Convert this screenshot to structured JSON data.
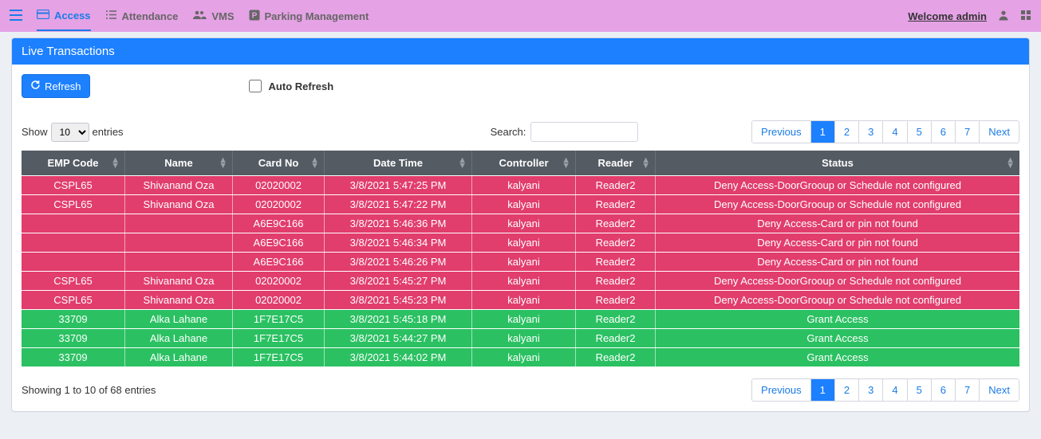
{
  "nav": {
    "access": "Access",
    "attendance": "Attendance",
    "vms": "VMS",
    "parking": "Parking Management",
    "welcome": "Welcome admin"
  },
  "panel": {
    "title": "Live Transactions",
    "refresh": "Refresh",
    "auto_refresh": "Auto Refresh"
  },
  "table_controls": {
    "show": "Show",
    "entries": "entries",
    "page_size": "10",
    "search_label": "Search:",
    "info": "Showing 1 to 10 of 68 entries"
  },
  "pager": {
    "previous": "Previous",
    "next": "Next",
    "pages": [
      "1",
      "2",
      "3",
      "4",
      "5",
      "6",
      "7"
    ],
    "active": "1"
  },
  "columns": {
    "emp": "EMP Code",
    "name": "Name",
    "card": "Card No",
    "date": "Date Time",
    "controller": "Controller",
    "reader": "Reader",
    "status": "Status"
  },
  "rows": [
    {
      "emp": "CSPL65",
      "name": "Shivanand Oza",
      "card": "02020002",
      "date": "3/8/2021 5:47:25 PM",
      "controller": "kalyani",
      "reader": "Reader2",
      "status": "Deny Access-DoorGrooup or Schedule not configured",
      "kind": "deny"
    },
    {
      "emp": "CSPL65",
      "name": "Shivanand Oza",
      "card": "02020002",
      "date": "3/8/2021 5:47:22 PM",
      "controller": "kalyani",
      "reader": "Reader2",
      "status": "Deny Access-DoorGrooup or Schedule not configured",
      "kind": "deny"
    },
    {
      "emp": "",
      "name": "",
      "card": "A6E9C166",
      "date": "3/8/2021 5:46:36 PM",
      "controller": "kalyani",
      "reader": "Reader2",
      "status": "Deny Access-Card or pin not found",
      "kind": "deny"
    },
    {
      "emp": "",
      "name": "",
      "card": "A6E9C166",
      "date": "3/8/2021 5:46:34 PM",
      "controller": "kalyani",
      "reader": "Reader2",
      "status": "Deny Access-Card or pin not found",
      "kind": "deny"
    },
    {
      "emp": "",
      "name": "",
      "card": "A6E9C166",
      "date": "3/8/2021 5:46:26 PM",
      "controller": "kalyani",
      "reader": "Reader2",
      "status": "Deny Access-Card or pin not found",
      "kind": "deny"
    },
    {
      "emp": "CSPL65",
      "name": "Shivanand Oza",
      "card": "02020002",
      "date": "3/8/2021 5:45:27 PM",
      "controller": "kalyani",
      "reader": "Reader2",
      "status": "Deny Access-DoorGrooup or Schedule not configured",
      "kind": "deny"
    },
    {
      "emp": "CSPL65",
      "name": "Shivanand Oza",
      "card": "02020002",
      "date": "3/8/2021 5:45:23 PM",
      "controller": "kalyani",
      "reader": "Reader2",
      "status": "Deny Access-DoorGrooup or Schedule not configured",
      "kind": "deny"
    },
    {
      "emp": "33709",
      "name": "Alka Lahane",
      "card": "1F7E17C5",
      "date": "3/8/2021 5:45:18 PM",
      "controller": "kalyani",
      "reader": "Reader2",
      "status": "Grant Access",
      "kind": "grant"
    },
    {
      "emp": "33709",
      "name": "Alka Lahane",
      "card": "1F7E17C5",
      "date": "3/8/2021 5:44:27 PM",
      "controller": "kalyani",
      "reader": "Reader2",
      "status": "Grant Access",
      "kind": "grant"
    },
    {
      "emp": "33709",
      "name": "Alka Lahane",
      "card": "1F7E17C5",
      "date": "3/8/2021 5:44:02 PM",
      "controller": "kalyani",
      "reader": "Reader2",
      "status": "Grant Access",
      "kind": "grant"
    }
  ]
}
